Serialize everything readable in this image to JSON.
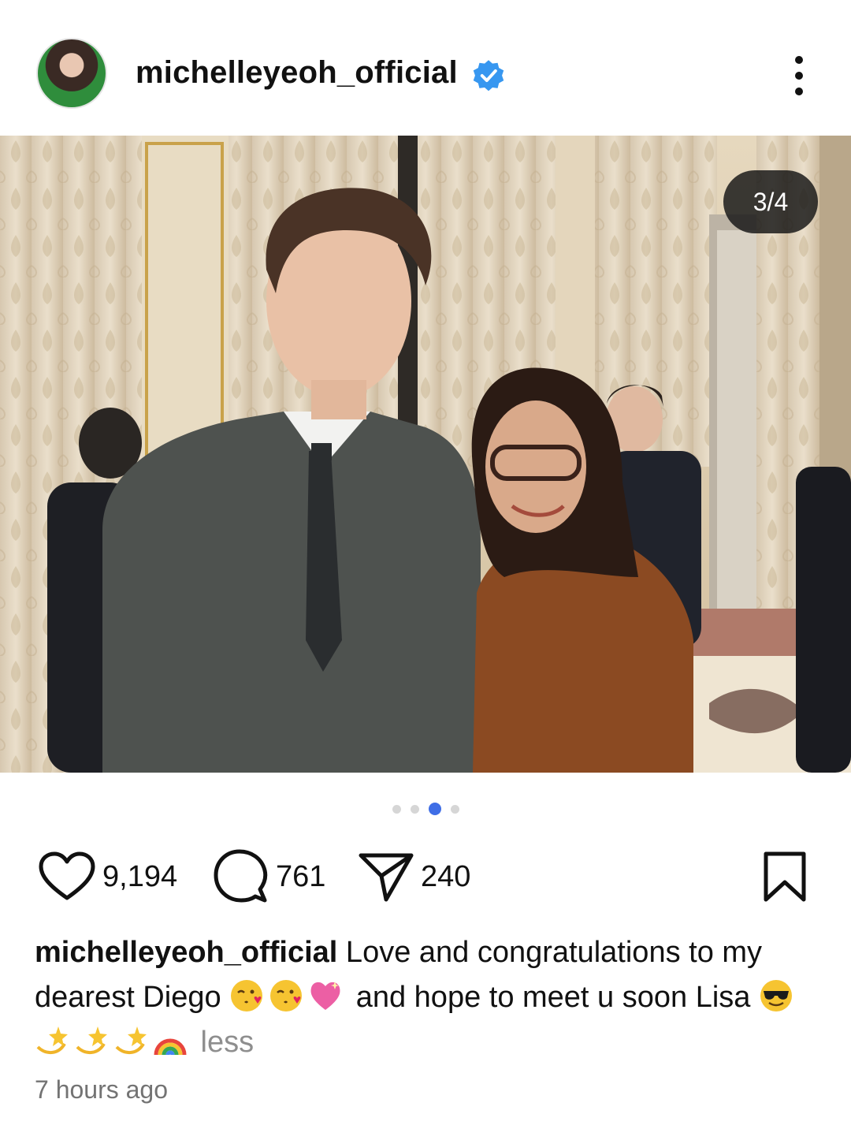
{
  "post": {
    "username": "michelleyeoh_official",
    "verified": true,
    "carousel_position": "3/4",
    "carousel_total": 4,
    "carousel_active_index": 3,
    "likes": "9,194",
    "comments": "761",
    "shares": "240",
    "caption": {
      "user": "michelleyeoh_official",
      "text_1": " Love and congratulations to my dearest Diego ",
      "emoji_1": [
        "kissing-face-heart",
        "kissing-face-heart",
        "sparkling-heart"
      ],
      "text_2": " and hope to meet u soon Lisa ",
      "emoji_2": [
        "smiling-face-sunglasses"
      ],
      "emoji_3": [
        "dizzy",
        "dizzy",
        "dizzy",
        "rainbow"
      ],
      "less_label": " less"
    },
    "timestamp": "7 hours ago"
  },
  "icons": {
    "verified": "verified-badge-icon",
    "more": "more-vertical-icon",
    "like": "heart-icon",
    "comment": "comment-bubble-icon",
    "share": "paper-plane-icon",
    "save": "bookmark-icon"
  },
  "colors": {
    "verified_blue": "#3797f0",
    "active_dot": "#3f6ee6",
    "muted_text": "#737373"
  }
}
